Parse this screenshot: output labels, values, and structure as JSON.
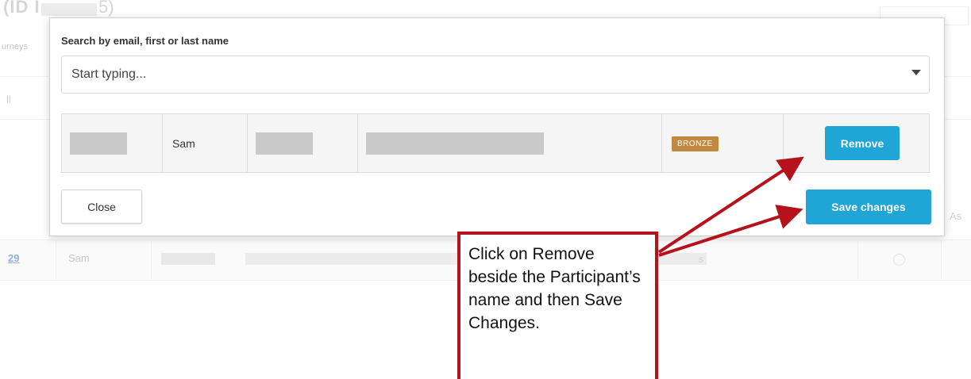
{
  "background": {
    "title_left": "(ID I",
    "title_right": "5)",
    "subtitle": "urneys",
    "column_fragment": "ll",
    "header_fragment": "As",
    "row": {
      "id": "29",
      "name": "Sam",
      "tail": "s"
    }
  },
  "modal": {
    "search_label": "Search by email, first or last name",
    "search_placeholder": "Start typing...",
    "participant": {
      "name": "Sam",
      "badge": "BRONZE",
      "remove_label": "Remove"
    },
    "close_label": "Close",
    "save_label": "Save changes"
  },
  "colors": {
    "primary": "#1fa5d6",
    "badge_bronze": "#c1883f",
    "annotation": "#b5121b"
  },
  "annotation": {
    "text": "Click on Remove beside the Participant’s name and then Save Changes."
  }
}
